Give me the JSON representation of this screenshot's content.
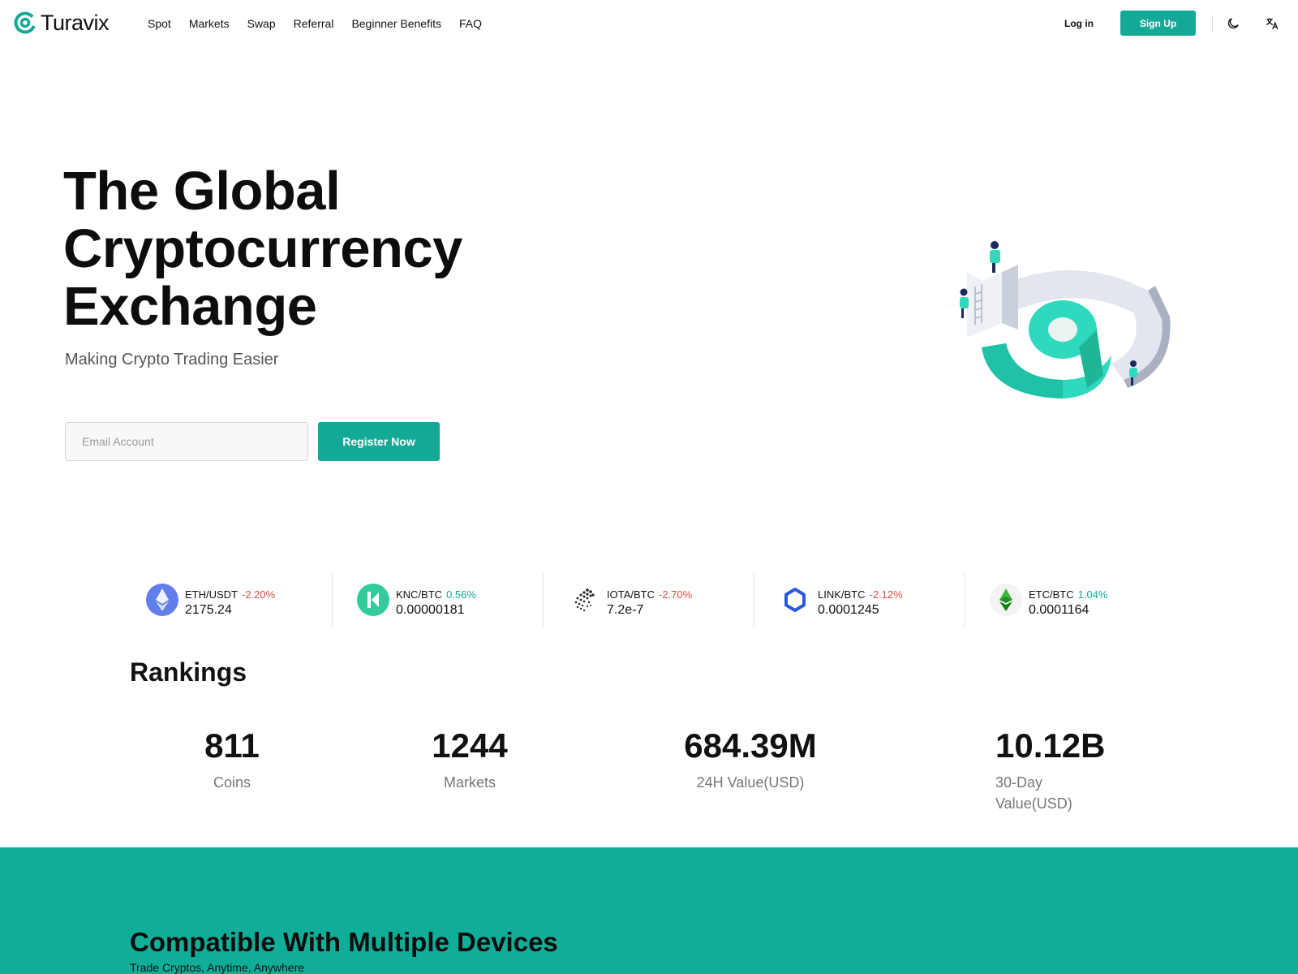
{
  "brand": {
    "name": "Turavix",
    "accent": "#14a997",
    "negative": "#e04b3e"
  },
  "nav": [
    {
      "label": "Spot"
    },
    {
      "label": "Markets"
    },
    {
      "label": "Swap"
    },
    {
      "label": "Referral"
    },
    {
      "label": "Beginner Benefits"
    },
    {
      "label": "FAQ"
    }
  ],
  "header": {
    "login_label": "Log in",
    "signup_label": "Sign Up",
    "theme_icon": "moon-icon",
    "language_icon": "translate-icon"
  },
  "hero": {
    "title_lines": [
      "The Global",
      "Cryptocurrency",
      "Exchange"
    ],
    "subtitle": "Making Crypto Trading Easier",
    "email_placeholder": "Email Account",
    "email_value": "",
    "register_label": "Register Now",
    "illustration": "isometric-logo-illustration"
  },
  "ticker": [
    {
      "pair": "ETH/USDT",
      "change": "-2.20%",
      "direction": "down",
      "price": "2175.24",
      "icon": "eth-icon"
    },
    {
      "pair": "KNC/BTC",
      "change": "0.56%",
      "direction": "up",
      "price": "0.00000181",
      "icon": "knc-icon"
    },
    {
      "pair": "IOTA/BTC",
      "change": "-2.70%",
      "direction": "down",
      "price": "7.2e-7",
      "icon": "iota-icon"
    },
    {
      "pair": "LINK/BTC",
      "change": "-2.12%",
      "direction": "down",
      "price": "0.0001245",
      "icon": "link-icon"
    },
    {
      "pair": "ETC/BTC",
      "change": "1.04%",
      "direction": "up",
      "price": "0.0001164",
      "icon": "etc-icon"
    }
  ],
  "rankings": {
    "title": "Rankings",
    "stats": [
      {
        "value": "811",
        "label": "Coins"
      },
      {
        "value": "1244",
        "label": "Markets"
      },
      {
        "value": "684.39M",
        "label": "24H Value(USD)"
      },
      {
        "value": "10.12B",
        "label": "30-Day Value(USD)"
      }
    ]
  },
  "compatible": {
    "title": "Compatible With Multiple Devices",
    "subtitle": "Trade Cryptos, Anytime, Anywhere"
  }
}
